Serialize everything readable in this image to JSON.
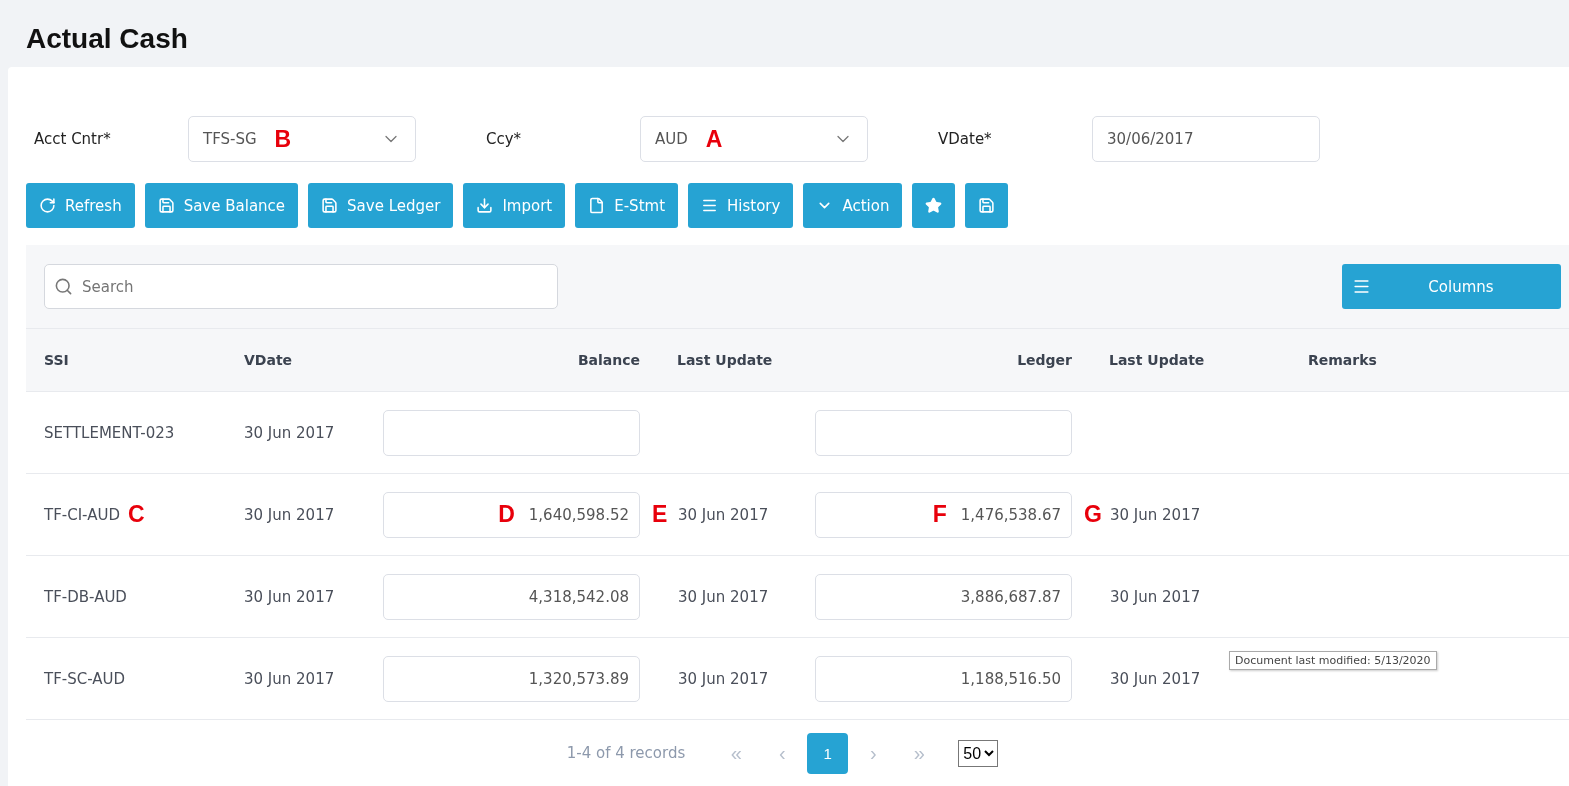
{
  "page": {
    "title": "Actual Cash"
  },
  "filters": [
    {
      "kind": "select",
      "label": "Acct Cntr*",
      "value": "TFS-SG",
      "marker": "B"
    },
    {
      "kind": "select",
      "label": "Ccy*",
      "value": "AUD",
      "marker": "A"
    },
    {
      "kind": "date",
      "label": "VDate*",
      "value": "30/06/2017"
    }
  ],
  "toolbar": [
    {
      "kind": "refresh",
      "label": "Refresh"
    },
    {
      "kind": "save",
      "label": "Save Balance"
    },
    {
      "kind": "save",
      "label": "Save Ledger"
    },
    {
      "kind": "import",
      "label": "Import"
    },
    {
      "kind": "file",
      "label": "E-Stmt"
    },
    {
      "kind": "list",
      "label": "History"
    },
    {
      "kind": "chevron",
      "label": "Action"
    },
    {
      "kind": "star"
    },
    {
      "kind": "save"
    }
  ],
  "search": {
    "placeholder": "Search"
  },
  "columns_button": "Columns",
  "table": {
    "columns": [
      "SSI",
      "VDate",
      "Balance",
      "Last Update",
      "Ledger",
      "Last Update",
      "Remarks"
    ],
    "rows": [
      {
        "ssi": "SETTLEMENT-023",
        "vdate": "30 Jun 2017"
      },
      {
        "ssi": "TF-CI-AUD",
        "vdate": "30 Jun 2017",
        "balance": "1,640,598.52",
        "balance_update": "30 Jun 2017",
        "ledger": "1,476,538.67",
        "ledger_update": "30 Jun 2017",
        "markers": {
          "ssi": "C",
          "balance": "D",
          "balance_update": "E",
          "ledger": "F",
          "ledger_update": "G"
        }
      },
      {
        "ssi": "TF-DB-AUD",
        "vdate": "30 Jun 2017",
        "balance": "4,318,542.08",
        "balance_update": "30 Jun 2017",
        "ledger": "3,886,687.87",
        "ledger_update": "30 Jun 2017"
      },
      {
        "ssi": "TF-SC-AUD",
        "vdate": "30 Jun 2017",
        "balance": "1,320,573.89",
        "balance_update": "30 Jun 2017",
        "ledger": "1,188,516.50",
        "ledger_update": "30 Jun 2017"
      }
    ]
  },
  "pagination": {
    "summary": "1-4 of 4 records",
    "first": "«",
    "prev": "‹",
    "pages": [
      {
        "label": "1",
        "selected": true
      }
    ],
    "next": "›",
    "last": "»",
    "page_size": "50"
  },
  "tooltip": "Document last modified: 5/13/2020"
}
